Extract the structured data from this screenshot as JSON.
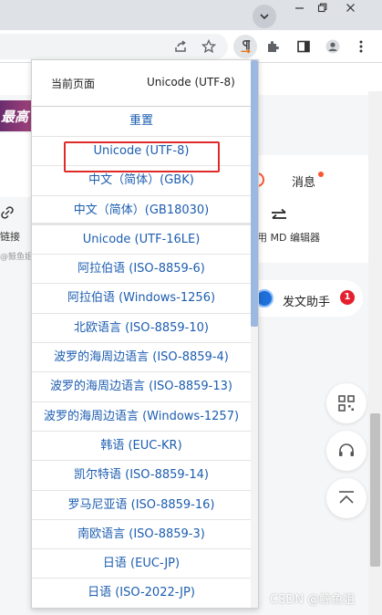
{
  "browser": {
    "window_controls": [
      "minimize-icon",
      "restore-icon",
      "close-icon"
    ],
    "tab_search_icon": "chevron-down-icon",
    "toolbar_icons": [
      "share-icon",
      "star-icon",
      "encoding-extension-icon",
      "puzzle-icon",
      "side-panel-icon",
      "profile-icon",
      "more-menu-icon"
    ]
  },
  "page": {
    "banner_text": "最高",
    "link_label": "链接",
    "link_sub": "@鲸鱼姐",
    "messages_label": "消息",
    "md_editor_label": "用 MD 编辑器",
    "assistant_label": "发文助手",
    "assistant_badge": "1",
    "float_buttons": [
      "qrcode-icon",
      "headset-icon",
      "back-to-top-icon"
    ],
    "watermark": "CSDN @鲸鱼姐"
  },
  "popup": {
    "current_page_label": "当前页面",
    "current_encoding": "Unicode (UTF-8)",
    "reset_label": "重置",
    "encodings": [
      {
        "label": "Unicode (UTF-8)",
        "highlighted": true
      },
      {
        "label": "中文（简体）(GBK)"
      },
      {
        "label": "中文（简体）(GB18030)"
      },
      {
        "label": "Unicode (UTF-16LE)"
      },
      {
        "label": "阿拉伯语 (ISO-8859-6)"
      },
      {
        "label": "阿拉伯语 (Windows-1256)"
      },
      {
        "label": "北欧语言 (ISO-8859-10)"
      },
      {
        "label": "波罗的海周边语言 (ISO-8859-4)"
      },
      {
        "label": "波罗的海周边语言 (ISO-8859-13)"
      },
      {
        "label": "波罗的海周边语言 (Windows-1257)"
      },
      {
        "label": "韩语 (EUC-KR)"
      },
      {
        "label": "凯尔特语 (ISO-8859-14)"
      },
      {
        "label": "罗马尼亚语 (ISO-8859-16)"
      },
      {
        "label": "南欧语言 (ISO-8859-3)"
      },
      {
        "label": "日语 (EUC-JP)"
      },
      {
        "label": "日语 (ISO-2022-JP)"
      }
    ]
  },
  "colors": {
    "link_blue": "#1c5db0",
    "highlight_red": "#e02a2a",
    "csdn_orange": "#fc5531"
  }
}
